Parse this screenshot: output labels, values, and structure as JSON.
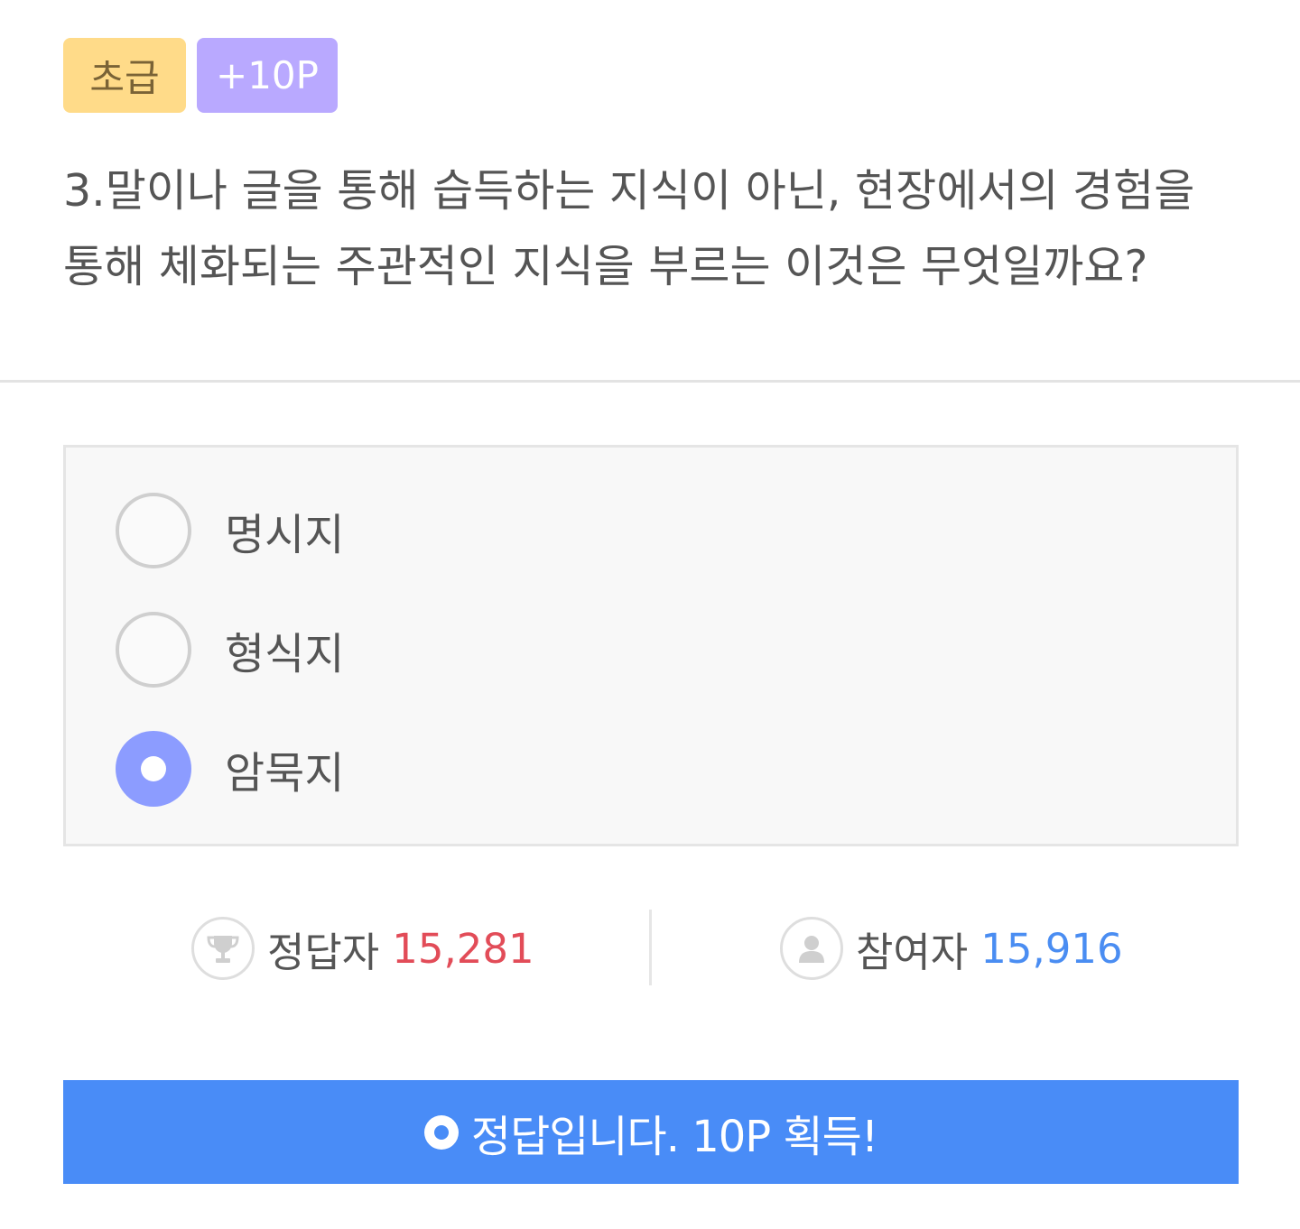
{
  "badges": {
    "level": "초급",
    "points": "+10P"
  },
  "question": {
    "text": "3.말이나 글을 통해 습득하는 지식이 아닌, 현장에서의 경험을 통해 체화되는 주관적인 지식을 부르는 이것은 무엇일까요?"
  },
  "options": [
    {
      "label": "명시지",
      "selected": false
    },
    {
      "label": "형식지",
      "selected": false
    },
    {
      "label": "암묵지",
      "selected": true
    }
  ],
  "stats": {
    "correct_label": "정답자",
    "correct_value": "15,281",
    "participants_label": "참여자",
    "participants_value": "15,916"
  },
  "result": {
    "text": "정답입니다. 10P 획득!"
  },
  "icons": {
    "correct": "trophy-icon",
    "participants": "person-icon",
    "result": "circle-icon"
  },
  "colors": {
    "level_badge": "#ffdb89",
    "points_badge": "#b9a9ff",
    "selected_radio": "#8c9cff",
    "correct_value": "#e24c58",
    "participants_value": "#4a8df2",
    "result_bar": "#498cf7"
  }
}
